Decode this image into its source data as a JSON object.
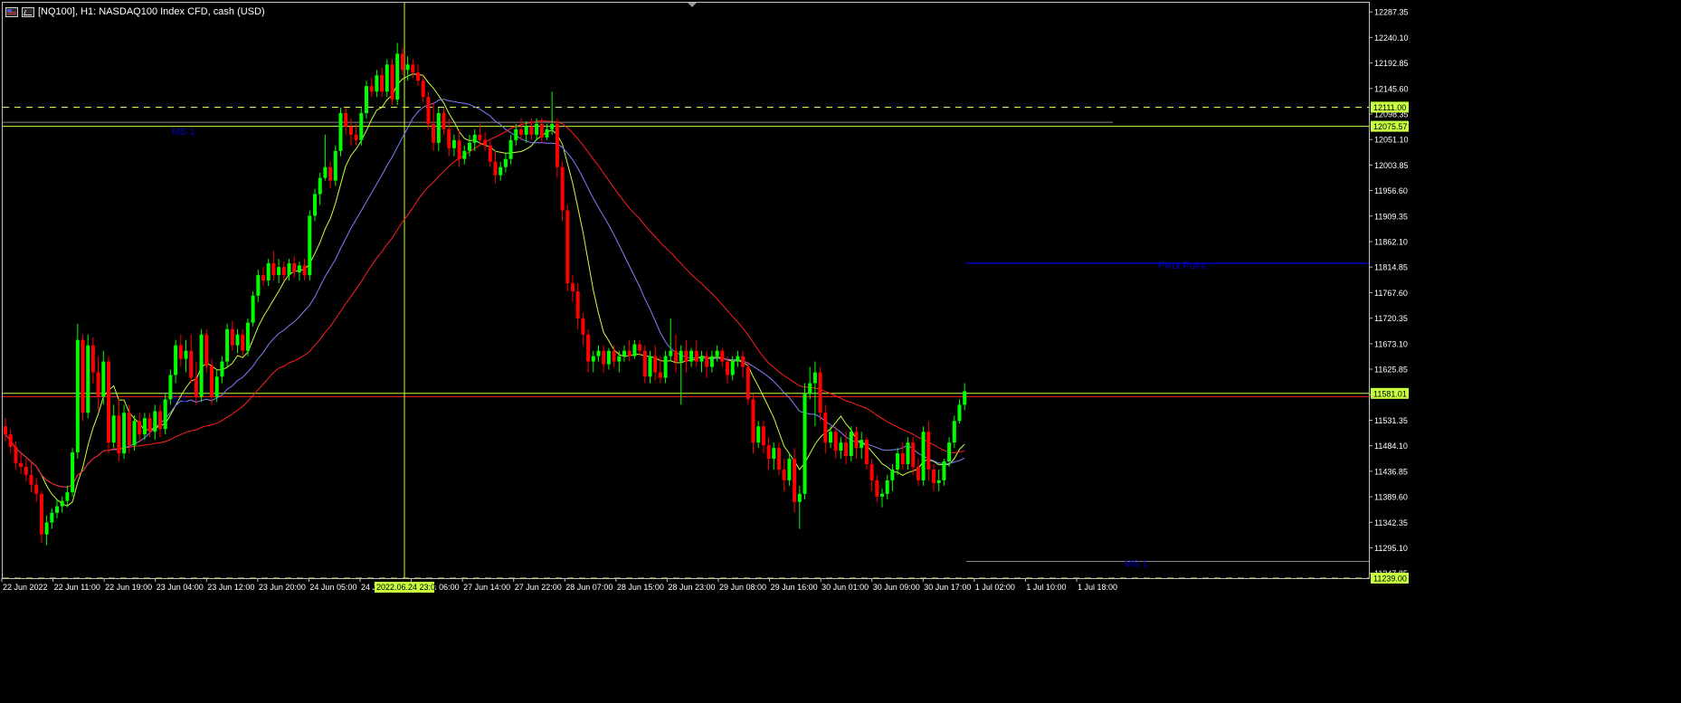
{
  "window": {
    "title": "[NQ100], H1:  NASDAQ100 Index CFD, cash (USD)"
  },
  "colors": {
    "background": "#000000",
    "bull": "#00ff00",
    "bear": "#ff0000",
    "ma_fast": "#c8ff40",
    "ma_mid": "#8080ff",
    "ma_slow": "#ff2020",
    "level_line": "#c8ff40",
    "pivot": "#0000c0",
    "axis_text": "#ffffff"
  },
  "chart_data": {
    "type": "candlestick",
    "symbol": "NQ100",
    "timeframe": "H1",
    "ylim": [
      11238.94,
      12304.4
    ],
    "y_ticks": [
      12287.35,
      12240.1,
      12192.85,
      12145.6,
      12098.35,
      12051.1,
      12003.85,
      11956.6,
      11909.35,
      11862.1,
      11814.85,
      11767.6,
      11720.35,
      11673.1,
      11625.85,
      11578.6,
      11531.35,
      11484.1,
      11436.85,
      11389.6,
      11342.35,
      11295.1,
      11247.85
    ],
    "x_ticks": [
      "22 Jun 2022",
      "22 Jun 11:00",
      "22 Jun 19:00",
      "23 Jun 04:00",
      "23 Jun 12:00",
      "23 Jun 20:00",
      "24 Jun 05:00",
      "24 Jun 13:00",
      "27 Jun 06:00",
      "27 Jun 14:00",
      "27 Jun 22:00",
      "28 Jun 07:00",
      "28 Jun 15:00",
      "28 Jun 23:00",
      "29 Jun 08:00",
      "29 Jun 16:00",
      "30 Jun 01:00",
      "30 Jun 09:00",
      "30 Jun 17:00",
      "1 Jul 02:00",
      "1 Jul 10:00",
      "1 Jul 18:00"
    ],
    "crosshair_label": "2022.06.24 23:00",
    "price_badges": [
      {
        "value": "12111.00",
        "bg": "#c8ff40",
        "fg": "#000000"
      },
      {
        "value": "12075.57",
        "bg": "#c8ff40",
        "fg": "#000000"
      },
      {
        "value": "11581.01",
        "bg": "#c8ff40",
        "fg": "#000000"
      },
      {
        "value": "11239.00",
        "bg": "#c8ff40",
        "fg": "#000000"
      }
    ],
    "level_labels": [
      {
        "text": "MS 1"
      },
      {
        "text": "S 1"
      },
      {
        "text": "Pivot Point"
      },
      {
        "text": "MS 1"
      }
    ],
    "candles": [
      [
        11520,
        11535,
        11492,
        11505
      ],
      [
        11505,
        11515,
        11470,
        11482
      ],
      [
        11482,
        11492,
        11440,
        11452
      ],
      [
        11452,
        11470,
        11432,
        11445
      ],
      [
        11445,
        11460,
        11418,
        11430
      ],
      [
        11430,
        11455,
        11398,
        11412
      ],
      [
        11412,
        11425,
        11380,
        11395
      ],
      [
        11395,
        11400,
        11305,
        11320
      ],
      [
        11320,
        11355,
        11300,
        11342
      ],
      [
        11342,
        11368,
        11330,
        11360
      ],
      [
        11360,
        11385,
        11350,
        11372
      ],
      [
        11372,
        11390,
        11360,
        11382
      ],
      [
        11382,
        11410,
        11370,
        11398
      ],
      [
        11398,
        11480,
        11390,
        11472
      ],
      [
        11472,
        11710,
        11460,
        11680
      ],
      [
        11680,
        11690,
        11530,
        11545
      ],
      [
        11545,
        11690,
        11535,
        11670
      ],
      [
        11670,
        11685,
        11600,
        11620
      ],
      [
        11620,
        11650,
        11550,
        11575
      ],
      [
        11575,
        11660,
        11560,
        11640
      ],
      [
        11640,
        11650,
        11470,
        11490
      ],
      [
        11490,
        11560,
        11480,
        11540
      ],
      [
        11540,
        11570,
        11455,
        11470
      ],
      [
        11470,
        11560,
        11460,
        11545
      ],
      [
        11545,
        11560,
        11470,
        11485
      ],
      [
        11485,
        11540,
        11475,
        11530
      ],
      [
        11530,
        11545,
        11490,
        11505
      ],
      [
        11505,
        11545,
        11495,
        11535
      ],
      [
        11535,
        11545,
        11500,
        11510
      ],
      [
        11510,
        11560,
        11495,
        11548
      ],
      [
        11548,
        11560,
        11500,
        11515
      ],
      [
        11515,
        11580,
        11505,
        11570
      ],
      [
        11570,
        11625,
        11560,
        11615
      ],
      [
        11615,
        11680,
        11600,
        11670
      ],
      [
        11670,
        11690,
        11630,
        11645
      ],
      [
        11645,
        11680,
        11620,
        11660
      ],
      [
        11660,
        11690,
        11600,
        11610
      ],
      [
        11610,
        11640,
        11560,
        11575
      ],
      [
        11575,
        11700,
        11565,
        11690
      ],
      [
        11690,
        11700,
        11620,
        11632
      ],
      [
        11632,
        11645,
        11560,
        11575
      ],
      [
        11575,
        11625,
        11565,
        11612
      ],
      [
        11612,
        11650,
        11600,
        11640
      ],
      [
        11640,
        11710,
        11630,
        11700
      ],
      [
        11700,
        11715,
        11660,
        11670
      ],
      [
        11670,
        11700,
        11655,
        11690
      ],
      [
        11690,
        11700,
        11650,
        11660
      ],
      [
        11660,
        11720,
        11650,
        11712
      ],
      [
        11712,
        11770,
        11705,
        11762
      ],
      [
        11762,
        11810,
        11750,
        11800
      ],
      [
        11800,
        11815,
        11780,
        11790
      ],
      [
        11790,
        11830,
        11780,
        11822
      ],
      [
        11822,
        11845,
        11790,
        11800
      ],
      [
        11800,
        11830,
        11785,
        11815
      ],
      [
        11815,
        11825,
        11790,
        11800
      ],
      [
        11800,
        11830,
        11790,
        11822
      ],
      [
        11822,
        11835,
        11795,
        11805
      ],
      [
        11805,
        11825,
        11790,
        11818
      ],
      [
        11818,
        11830,
        11790,
        11800
      ],
      [
        11800,
        11920,
        11790,
        11910
      ],
      [
        11910,
        11960,
        11900,
        11950
      ],
      [
        11950,
        11990,
        11930,
        11980
      ],
      [
        11980,
        12060,
        11975,
        12000
      ],
      [
        12000,
        12010,
        11960,
        11975
      ],
      [
        11975,
        12040,
        11965,
        12030
      ],
      [
        12030,
        12110,
        12020,
        12100
      ],
      [
        12100,
        12110,
        12060,
        12075
      ],
      [
        12075,
        12090,
        12040,
        12060
      ],
      [
        12060,
        12080,
        12040,
        12050
      ],
      [
        12050,
        12110,
        12040,
        12100
      ],
      [
        12100,
        12160,
        12090,
        12150
      ],
      [
        12150,
        12165,
        12130,
        12140
      ],
      [
        12140,
        12180,
        12130,
        12170
      ],
      [
        12170,
        12185,
        12130,
        12140
      ],
      [
        12140,
        12200,
        12130,
        12190
      ],
      [
        12190,
        12200,
        12115,
        12125
      ],
      [
        12125,
        12230,
        12115,
        12210
      ],
      [
        12210,
        12220,
        12170,
        12180
      ],
      [
        12180,
        12205,
        12160,
        12190
      ],
      [
        12190,
        12200,
        12165,
        12175
      ],
      [
        12175,
        12190,
        12150,
        12160
      ],
      [
        12160,
        12170,
        12120,
        12130
      ],
      [
        12130,
        12140,
        12070,
        12080
      ],
      [
        12080,
        12120,
        12030,
        12045
      ],
      [
        12045,
        12110,
        12030,
        12100
      ],
      [
        12100,
        12110,
        12060,
        12070
      ],
      [
        12070,
        12090,
        12020,
        12035
      ],
      [
        12035,
        12060,
        12020,
        12050
      ],
      [
        12050,
        12070,
        12000,
        12015
      ],
      [
        12015,
        12040,
        12005,
        12030
      ],
      [
        12030,
        12060,
        12020,
        12045
      ],
      [
        12045,
        12070,
        12030,
        12060
      ],
      [
        12060,
        12080,
        12040,
        12050
      ],
      [
        12050,
        12065,
        12030,
        12040
      ],
      [
        12040,
        12050,
        12000,
        12010
      ],
      [
        12010,
        12030,
        11970,
        11985
      ],
      [
        11985,
        12010,
        11975,
        12000
      ],
      [
        12000,
        12025,
        11990,
        12015
      ],
      [
        12015,
        12060,
        12005,
        12050
      ],
      [
        12050,
        12080,
        12040,
        12070
      ],
      [
        12070,
        12090,
        12050,
        12060
      ],
      [
        12060,
        12085,
        12045,
        12075
      ],
      [
        12075,
        12090,
        12050,
        12060
      ],
      [
        12060,
        12090,
        12050,
        12080
      ],
      [
        12080,
        12090,
        12045,
        12055
      ],
      [
        12055,
        12080,
        12050,
        12070
      ],
      [
        12070,
        12140,
        12060,
        12080
      ],
      [
        12080,
        12090,
        11980,
        12000
      ],
      [
        12000,
        12010,
        11900,
        11920
      ],
      [
        11920,
        11930,
        11770,
        11785
      ],
      [
        11785,
        11800,
        11750,
        11770
      ],
      [
        11770,
        11785,
        11700,
        11720
      ],
      [
        11720,
        11730,
        11670,
        11690
      ],
      [
        11690,
        11700,
        11620,
        11640
      ],
      [
        11640,
        11660,
        11620,
        11650
      ],
      [
        11650,
        11670,
        11640,
        11660
      ],
      [
        11660,
        11670,
        11620,
        11635
      ],
      [
        11635,
        11665,
        11625,
        11660
      ],
      [
        11660,
        11670,
        11630,
        11640
      ],
      [
        11640,
        11660,
        11620,
        11650
      ],
      [
        11650,
        11670,
        11640,
        11660
      ],
      [
        11660,
        11680,
        11640,
        11650
      ],
      [
        11650,
        11680,
        11645,
        11672
      ],
      [
        11672,
        11680,
        11650,
        11660
      ],
      [
        11660,
        11670,
        11600,
        11612
      ],
      [
        11612,
        11660,
        11600,
        11650
      ],
      [
        11650,
        11670,
        11605,
        11620
      ],
      [
        11620,
        11650,
        11600,
        11610
      ],
      [
        11610,
        11660,
        11600,
        11650
      ],
      [
        11650,
        11720,
        11640,
        11660
      ],
      [
        11660,
        11690,
        11620,
        11640
      ],
      [
        11640,
        11670,
        11560,
        11660
      ],
      [
        11660,
        11680,
        11620,
        11640
      ],
      [
        11640,
        11665,
        11630,
        11660
      ],
      [
        11660,
        11680,
        11630,
        11640
      ],
      [
        11640,
        11660,
        11620,
        11650
      ],
      [
        11650,
        11660,
        11610,
        11630
      ],
      [
        11630,
        11660,
        11620,
        11650
      ],
      [
        11650,
        11670,
        11640,
        11660
      ],
      [
        11660,
        11665,
        11630,
        11640
      ],
      [
        11640,
        11650,
        11600,
        11615
      ],
      [
        11615,
        11650,
        11605,
        11640
      ],
      [
        11640,
        11660,
        11630,
        11650
      ],
      [
        11650,
        11660,
        11610,
        11630
      ],
      [
        11630,
        11640,
        11560,
        11570
      ],
      [
        11570,
        11580,
        11470,
        11490
      ],
      [
        11490,
        11530,
        11480,
        11520
      ],
      [
        11520,
        11530,
        11470,
        11485
      ],
      [
        11485,
        11500,
        11440,
        11460
      ],
      [
        11460,
        11490,
        11440,
        11480
      ],
      [
        11480,
        11490,
        11430,
        11440
      ],
      [
        11440,
        11460,
        11400,
        11420
      ],
      [
        11420,
        11470,
        11410,
        11460
      ],
      [
        11460,
        11480,
        11360,
        11380
      ],
      [
        11380,
        11410,
        11330,
        11395
      ],
      [
        11395,
        11600,
        11385,
        11580
      ],
      [
        11580,
        11630,
        11570,
        11600
      ],
      [
        11600,
        11640,
        11520,
        11620
      ],
      [
        11620,
        11630,
        11530,
        11545
      ],
      [
        11545,
        11560,
        11470,
        11490
      ],
      [
        11490,
        11520,
        11480,
        11510
      ],
      [
        11510,
        11520,
        11460,
        11475
      ],
      [
        11475,
        11500,
        11460,
        11490
      ],
      [
        11490,
        11510,
        11450,
        11465
      ],
      [
        11465,
        11520,
        11455,
        11510
      ],
      [
        11510,
        11520,
        11460,
        11480
      ],
      [
        11480,
        11510,
        11460,
        11495
      ],
      [
        11495,
        11500,
        11440,
        11450
      ],
      [
        11450,
        11460,
        11400,
        11420
      ],
      [
        11420,
        11430,
        11380,
        11390
      ],
      [
        11390,
        11405,
        11370,
        11395
      ],
      [
        11395,
        11430,
        11385,
        11420
      ],
      [
        11420,
        11450,
        11400,
        11440
      ],
      [
        11440,
        11480,
        11430,
        11470
      ],
      [
        11470,
        11490,
        11440,
        11450
      ],
      [
        11450,
        11500,
        11440,
        11490
      ],
      [
        11490,
        11500,
        11430,
        11445
      ],
      [
        11445,
        11460,
        11410,
        11420
      ],
      [
        11420,
        11520,
        11410,
        11510
      ],
      [
        11510,
        11530,
        11420,
        11440
      ],
      [
        11440,
        11450,
        11400,
        11415
      ],
      [
        11415,
        11440,
        11400,
        11420
      ],
      [
        11420,
        11460,
        11410,
        11455
      ],
      [
        11455,
        11500,
        11445,
        11490
      ],
      [
        11490,
        11540,
        11480,
        11530
      ],
      [
        11530,
        11570,
        11525,
        11560
      ],
      [
        11560,
        11600,
        11550,
        11585
      ]
    ]
  }
}
